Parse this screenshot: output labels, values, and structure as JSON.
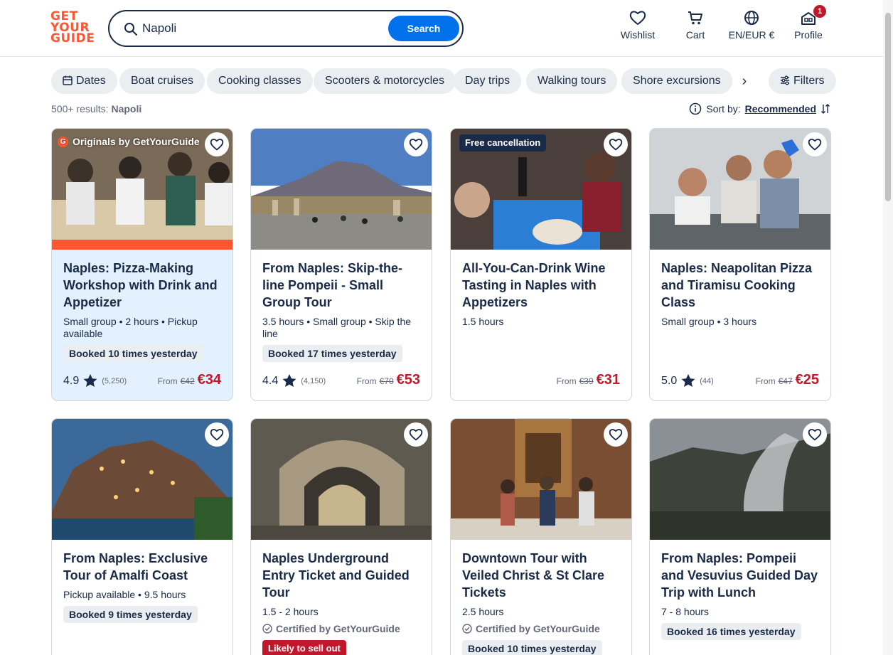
{
  "logo": {
    "line1": "GET",
    "line2": "YOUR",
    "line3": "GUIDE"
  },
  "search": {
    "value": "Napoli",
    "button": "Search"
  },
  "nav": {
    "wishlist": "Wishlist",
    "cart": "Cart",
    "language": "EN/EUR €",
    "profile": "Profile",
    "profile_badge": "1"
  },
  "chips": [
    "Dates",
    "Boat cruises",
    "Cooking classes",
    "Scooters & motorcycles",
    "Day trips",
    "Walking tours",
    "Shore excursions"
  ],
  "filters_label": "Filters",
  "results": {
    "count": "500+ results:",
    "query": "Napoli"
  },
  "sort": {
    "label": "Sort by:",
    "value": "Recommended"
  },
  "cards": [
    {
      "title": "Naples: Pizza-Making Workshop with Drink and Appetizer",
      "meta": "Small group • 2 hours • Pickup available",
      "booked": "Booked 10 times yesterday",
      "rating": "4.9",
      "reviews": "(5,250)",
      "from": "From",
      "old_price": "€42",
      "price": "€34",
      "badge": "Originals by GetYourGuide"
    },
    {
      "title": "From Naples: Skip-the-line Pompeii - Small Group Tour",
      "meta": "3.5 hours • Small group • Skip the line",
      "booked": "Booked 17 times yesterday",
      "rating": "4.4",
      "reviews": "(4,150)",
      "from": "From",
      "old_price": "€70",
      "price": "€53"
    },
    {
      "title": "All-You-Can-Drink Wine Tasting in Naples with Appetizers",
      "meta": "1.5 hours",
      "from": "From",
      "old_price": "€39",
      "price": "€31",
      "badge": "Free cancellation"
    },
    {
      "title": "Naples: Neapolitan Pizza and Tiramisu Cooking Class",
      "meta": "Small group • 3 hours",
      "rating": "5.0",
      "reviews": "(44)",
      "from": "From",
      "old_price": "€47",
      "price": "€25"
    },
    {
      "title": "From Naples: Exclusive Tour of Amalfi Coast",
      "meta": "Pickup available • 9.5 hours",
      "booked": "Booked 9 times yesterday"
    },
    {
      "title": "Naples Underground Entry Ticket and Guided Tour",
      "meta": "1.5 - 2 hours",
      "certified": "Certified by GetYourGuide",
      "sellout": "Likely to sell out"
    },
    {
      "title": "Downtown Tour with Veiled Christ & St Clare Tickets",
      "meta": "2.5 hours",
      "certified": "Certified by GetYourGuide",
      "booked": "Booked 10 times yesterday"
    },
    {
      "title": "From Naples: Pompeii and Vesuvius Guided Day Trip with Lunch",
      "meta": "7 - 8 hours",
      "booked": "Booked 16 times yesterday"
    }
  ],
  "colors": {
    "brand": "#ff5533",
    "primary": "#0071eb",
    "price": "#c1172b",
    "text": "#1a2b49"
  }
}
